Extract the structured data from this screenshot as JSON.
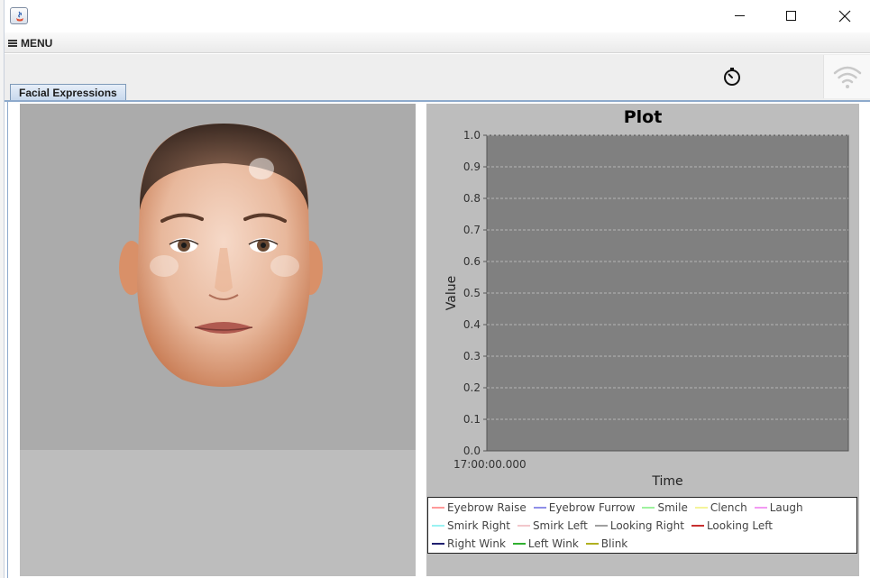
{
  "window": {
    "title": "",
    "controls": [
      "minimize",
      "maximize",
      "close"
    ]
  },
  "menubar": {
    "menu_label": "MENU"
  },
  "toolbar": {
    "icons": [
      "stopwatch-icon",
      "wifi-icon"
    ]
  },
  "tabs": [
    {
      "label": "Facial Expressions",
      "selected": true
    }
  ],
  "colors": {
    "tab_accent": "#8eaacc",
    "plot_background": "#808080",
    "panel_background": "#bdbdbd"
  },
  "chart_data": {
    "type": "line",
    "title": "Plot",
    "xlabel": "Time",
    "ylabel": "Value",
    "ylim": [
      0.0,
      1.0
    ],
    "y_ticks": [
      "0.0",
      "0.1",
      "0.2",
      "0.3",
      "0.4",
      "0.5",
      "0.6",
      "0.7",
      "0.8",
      "0.9",
      "1.0"
    ],
    "x_ticks": [
      "17:00:00.000"
    ],
    "grid": true,
    "legend_position": "bottom",
    "series": [
      {
        "name": "Eyebrow Raise",
        "color": "#ff9a9a",
        "values": []
      },
      {
        "name": "Eyebrow Furrow",
        "color": "#8f8fe8",
        "values": []
      },
      {
        "name": "Smile",
        "color": "#9ef29e",
        "values": []
      },
      {
        "name": "Clench",
        "color": "#f4f49a",
        "values": []
      },
      {
        "name": "Laugh",
        "color": "#f29af2",
        "values": []
      },
      {
        "name": "Smirk Right",
        "color": "#9af2f2",
        "values": []
      },
      {
        "name": "Smirk Left",
        "color": "#f2c8cc",
        "values": []
      },
      {
        "name": "Looking Right",
        "color": "#a0a0a0",
        "values": []
      },
      {
        "name": "Looking Left",
        "color": "#c83030",
        "values": []
      },
      {
        "name": "Right Wink",
        "color": "#202070",
        "values": []
      },
      {
        "name": "Left Wink",
        "color": "#30b030",
        "values": []
      },
      {
        "name": "Blink",
        "color": "#b0b020",
        "values": []
      }
    ]
  }
}
